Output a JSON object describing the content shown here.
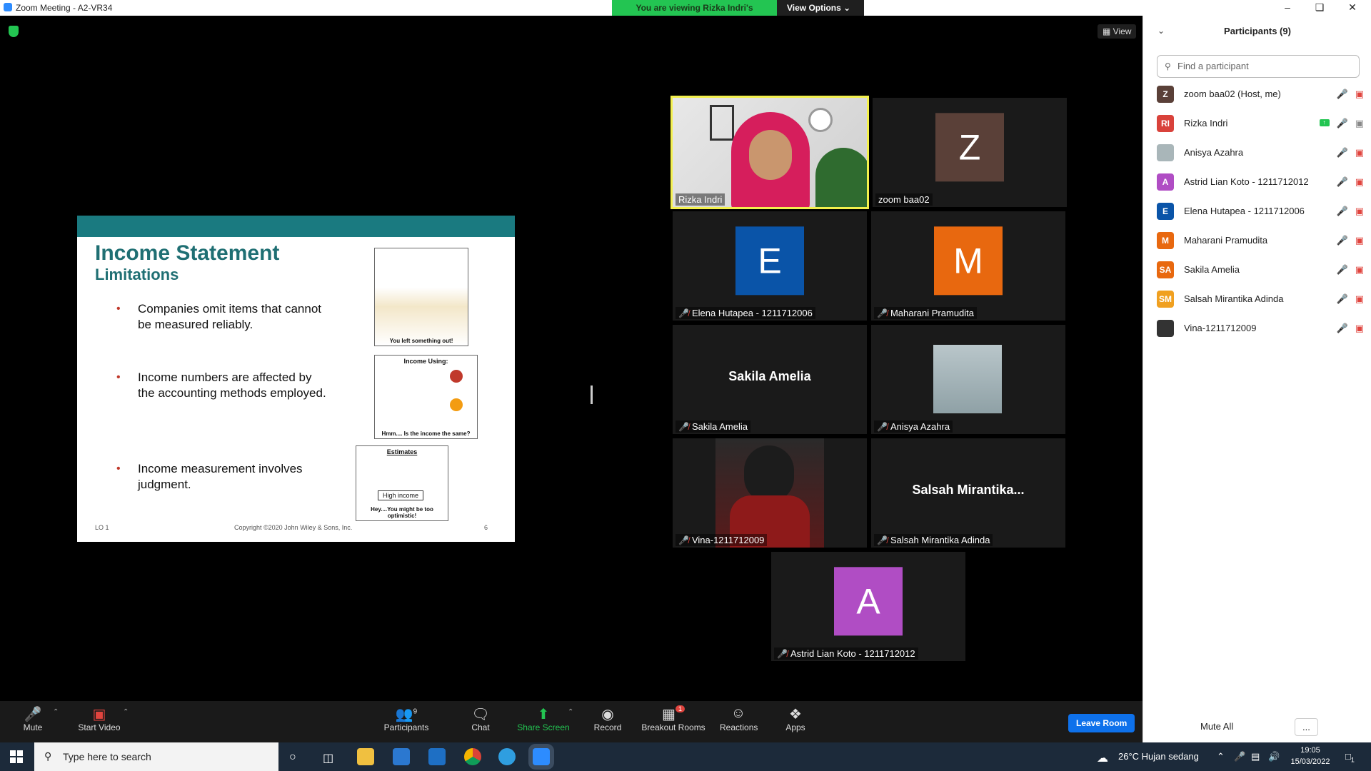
{
  "window": {
    "title": "Zoom Meeting - A2-VR34"
  },
  "banner": {
    "message": "You are viewing Rizka Indri's screen",
    "options": "View Options ⌄"
  },
  "view_button": "View",
  "slide": {
    "title": "Income Statement",
    "subtitle": "Limitations",
    "bullets": [
      "Companies omit items that cannot be measured reliably.",
      "Income numbers are affected by the accounting methods employed.",
      "Income measurement involves judgment."
    ],
    "images": [
      {
        "caption": "You left something out!"
      },
      {
        "header": "Income Using:",
        "caption": "Hmm.... Is the income the same?"
      },
      {
        "header": "Estimates",
        "box": "High income",
        "caption": "Hey....You might be too optimistic!"
      }
    ],
    "footer": {
      "left": "LO 1",
      "center": "Copyright ©2020 John Wiley & Sons, Inc.",
      "right": "6"
    }
  },
  "tiles": [
    {
      "label": "Rizka Indri",
      "initial": "",
      "color": ""
    },
    {
      "label": "zoom baa02",
      "initial": "Z",
      "color": "#5a4038"
    },
    {
      "label": "Elena Hutapea - 1211712006",
      "initial": "E",
      "color": "#0a54a8"
    },
    {
      "label": "Maharani Pramudita",
      "initial": "M",
      "color": "#e8680f"
    },
    {
      "label": "Sakila Amelia",
      "bigname": "Sakila Amelia"
    },
    {
      "label": "Anisya Azahra"
    },
    {
      "label": "Vina-1211712009"
    },
    {
      "label": "Salsah Mirantika Adinda",
      "bigname": "Salsah  Mirantika..."
    },
    {
      "label": "Astrid Lian Koto - 1211712012",
      "initial": "A",
      "color": "#b04dc4"
    }
  ],
  "participants_panel": {
    "title": "Participants (9)",
    "search_placeholder": "Find a participant",
    "list": [
      {
        "name": "zoom baa02 (Host, me)",
        "initials": "Z",
        "color": "#5a4038"
      },
      {
        "name": "Rizka Indri",
        "initials": "RI",
        "color": "#d9423b"
      },
      {
        "name": "Anisya Azahra",
        "initials": "",
        "color": "#a9b6b9"
      },
      {
        "name": "Astrid Lian Koto - 1211712012",
        "initials": "A",
        "color": "#b04dc4"
      },
      {
        "name": "Elena Hutapea - 1211712006",
        "initials": "E",
        "color": "#0a54a8"
      },
      {
        "name": "Maharani Pramudita",
        "initials": "M",
        "color": "#e8680f"
      },
      {
        "name": "Sakila Amelia",
        "initials": "SA",
        "color": "#e8680f"
      },
      {
        "name": "Salsah Mirantika Adinda",
        "initials": "SM",
        "color": "#f0a020"
      },
      {
        "name": "Vina-1211712009",
        "initials": "",
        "color": "#333"
      }
    ],
    "mute_all": "Mute All",
    "more": "..."
  },
  "toolbar": {
    "mute": "Mute",
    "start_video": "Start Video",
    "participants": "Participants",
    "participants_count": "9",
    "chat": "Chat",
    "share_screen": "Share Screen",
    "record": "Record",
    "breakout": "Breakout Rooms",
    "breakout_badge": "1",
    "reactions": "Reactions",
    "apps": "Apps",
    "leave": "Leave Room"
  },
  "taskbar": {
    "search_placeholder": "Type here to search",
    "weather": "26°C  Hujan sedang",
    "time": "19:05",
    "date": "15/03/2022",
    "notif_count": "1"
  }
}
